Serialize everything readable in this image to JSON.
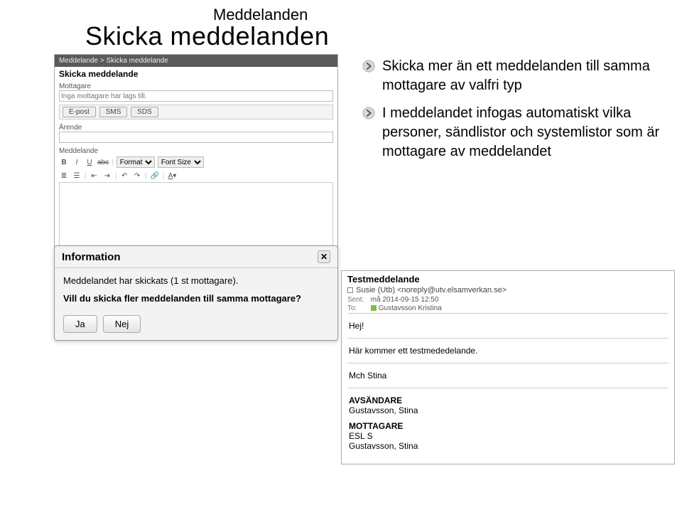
{
  "page": {
    "subtitle": "Meddelanden",
    "title": "Skicka meddelanden"
  },
  "compose": {
    "breadcrumb": "Meddelande > Skicka meddelande",
    "heading": "Skicka meddelande",
    "recipients_label": "Mottagare",
    "recipients_placeholder": "Inga mottagare har lags till.",
    "tabs": {
      "epost": "E-post",
      "sms": "SMS",
      "sds": "SDS"
    },
    "subject_label": "Ärende",
    "body_label": "Meddelande",
    "toolbar": {
      "format_label": "Format",
      "fontsize_label": "Font Size"
    }
  },
  "bullets": [
    "Skicka mer än ett meddelanden till samma mottagare av valfri typ",
    "I meddelandet infogas automatiskt vilka personer, sändlistor och systemlistor som är mottagare av meddelandet"
  ],
  "dialog": {
    "title": "Information",
    "line1": "Meddelandet har skickats (1 st mottagare).",
    "line2": "Vill du skicka fler meddelanden till samma mottagare?",
    "yes": "Ja",
    "no": "Nej"
  },
  "preview": {
    "subject": "Testmeddelande",
    "from": "Susie (Utb) <noreply@utv.elsamverkan.se>",
    "sent_label": "Sent:",
    "sent_value": "må 2014-09-15 12:50",
    "to_label": "To:",
    "to_value": "Gustavsson Kristina",
    "body1": "Hej!",
    "body2": "Här kommer ett testmededelande.",
    "body3": "Mch Stina",
    "sender_head": "AVSÄNDARE",
    "sender_name": "Gustavsson, Stina",
    "recipient_head": "MOTTAGARE",
    "recipient_line1": "ESL S",
    "recipient_line2": "Gustavsson, Stina"
  }
}
